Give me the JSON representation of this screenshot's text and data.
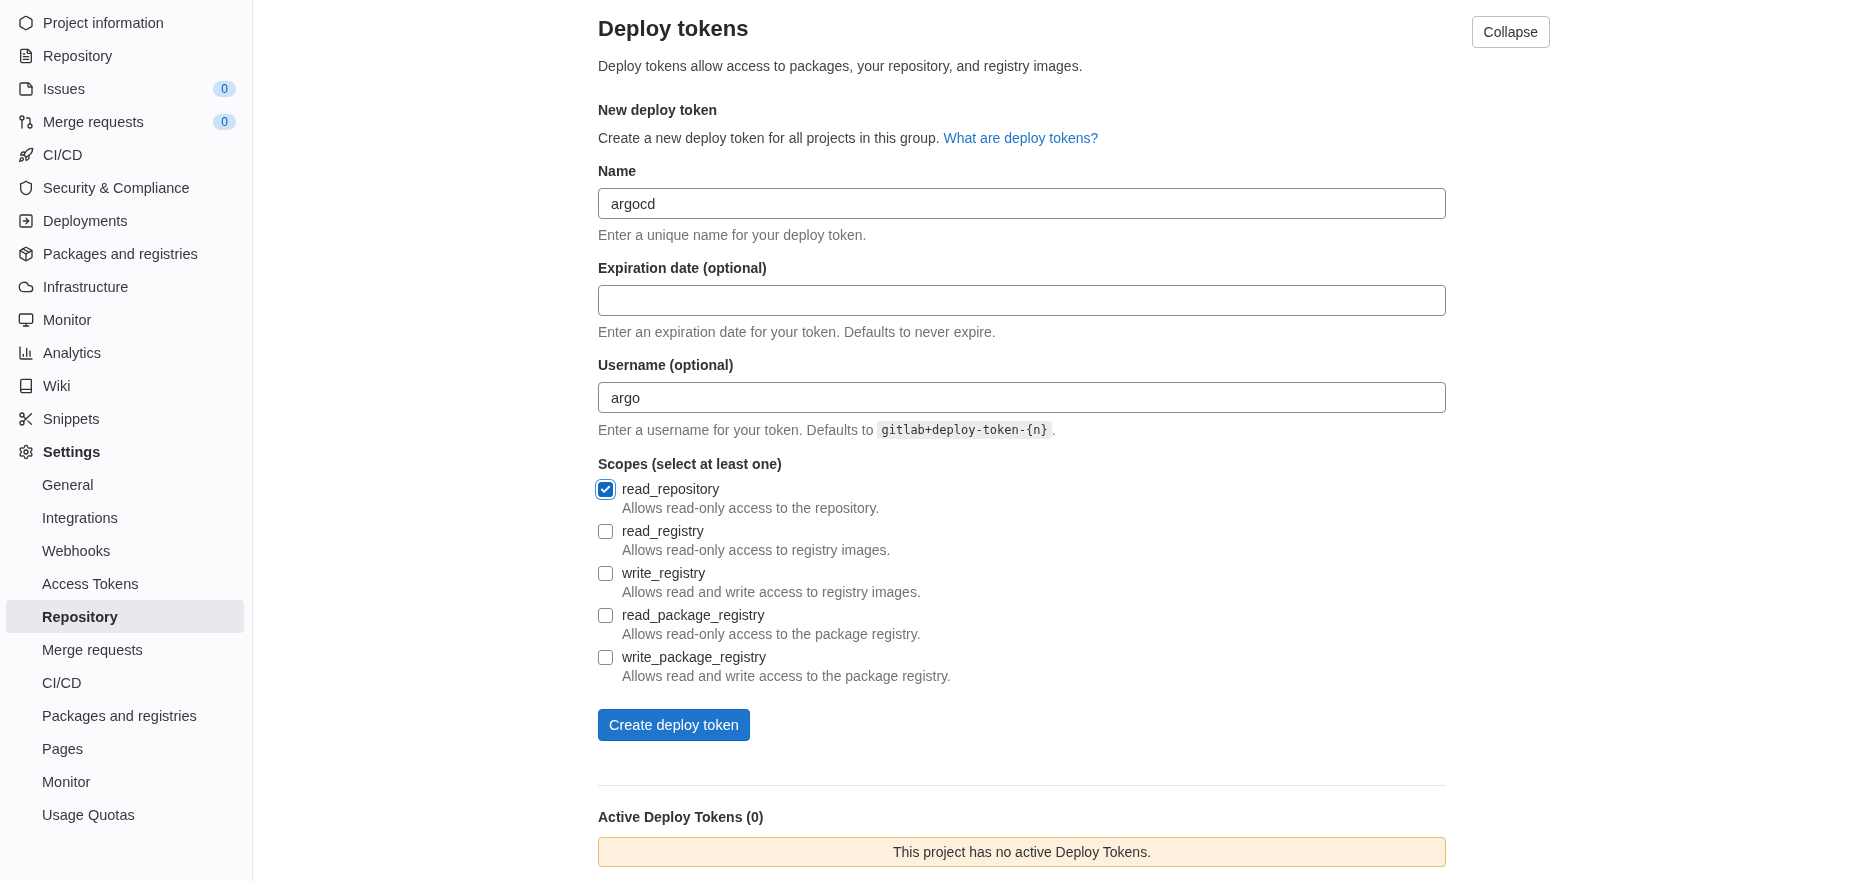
{
  "sidebar": {
    "items": [
      {
        "label": "Project information",
        "selected": false
      },
      {
        "label": "Repository",
        "selected": false
      },
      {
        "label": "Issues",
        "selected": false,
        "count": "0"
      },
      {
        "label": "Merge requests",
        "selected": false,
        "count": "0"
      },
      {
        "label": "CI/CD",
        "selected": false
      },
      {
        "label": "Security & Compliance",
        "selected": false
      },
      {
        "label": "Deployments",
        "selected": false
      },
      {
        "label": "Packages and registries",
        "selected": false
      },
      {
        "label": "Infrastructure",
        "selected": false
      },
      {
        "label": "Monitor",
        "selected": false
      },
      {
        "label": "Analytics",
        "selected": false
      },
      {
        "label": "Wiki",
        "selected": false
      },
      {
        "label": "Snippets",
        "selected": false
      },
      {
        "label": "Settings",
        "selected": true,
        "children": [
          {
            "label": "General",
            "selected": false
          },
          {
            "label": "Integrations",
            "selected": false
          },
          {
            "label": "Webhooks",
            "selected": false
          },
          {
            "label": "Access Tokens",
            "selected": false
          },
          {
            "label": "Repository",
            "selected": true
          },
          {
            "label": "Merge requests",
            "selected": false
          },
          {
            "label": "CI/CD",
            "selected": false
          },
          {
            "label": "Packages and registries",
            "selected": false
          },
          {
            "label": "Pages",
            "selected": false
          },
          {
            "label": "Monitor",
            "selected": false
          },
          {
            "label": "Usage Quotas",
            "selected": false
          }
        ]
      }
    ]
  },
  "section": {
    "title": "Deploy tokens",
    "collapse_button": "Collapse",
    "description": "Deploy tokens allow access to packages, your repository, and registry images.",
    "form": {
      "title": "New deploy token",
      "intro": "Create a new deploy token for all projects in this group.",
      "intro_link": "What are deploy tokens?",
      "fields": [
        {
          "label": "Name",
          "value": "argocd",
          "help": [
            {
              "kind": "text",
              "text": "Enter a unique name for your deploy token."
            }
          ]
        },
        {
          "label": "Expiration date (optional)",
          "help": [
            {
              "kind": "text",
              "text": "Enter an expiration date for your token. Defaults to never expire."
            }
          ]
        },
        {
          "label": "Username (optional)",
          "value": "argo",
          "help": [
            {
              "kind": "text",
              "text": "Enter a username for your token. Defaults to"
            },
            {
              "kind": "code",
              "text": "gitlab+deploy-token-{n}"
            },
            {
              "kind": "text",
              "text": "."
            }
          ]
        }
      ],
      "scopes_label": "Scopes (select at least one)",
      "scopes": [
        {
          "name": "read_repository",
          "description": "Allows read-only access to the repository.",
          "checked": true
        },
        {
          "name": "read_registry",
          "description": "Allows read-only access to registry images.",
          "checked": false
        },
        {
          "name": "write_registry",
          "description": "Allows read and write access to registry images.",
          "checked": false
        },
        {
          "name": "read_package_registry",
          "description": "Allows read-only access to the package registry.",
          "checked": false
        },
        {
          "name": "write_package_registry",
          "description": "Allows read and write access to the package registry.",
          "checked": false
        }
      ],
      "submit_button": "Create deploy token"
    },
    "active": {
      "title": "Active Deploy Tokens (0)",
      "empty_message": "This project has no active Deploy Tokens."
    }
  }
}
